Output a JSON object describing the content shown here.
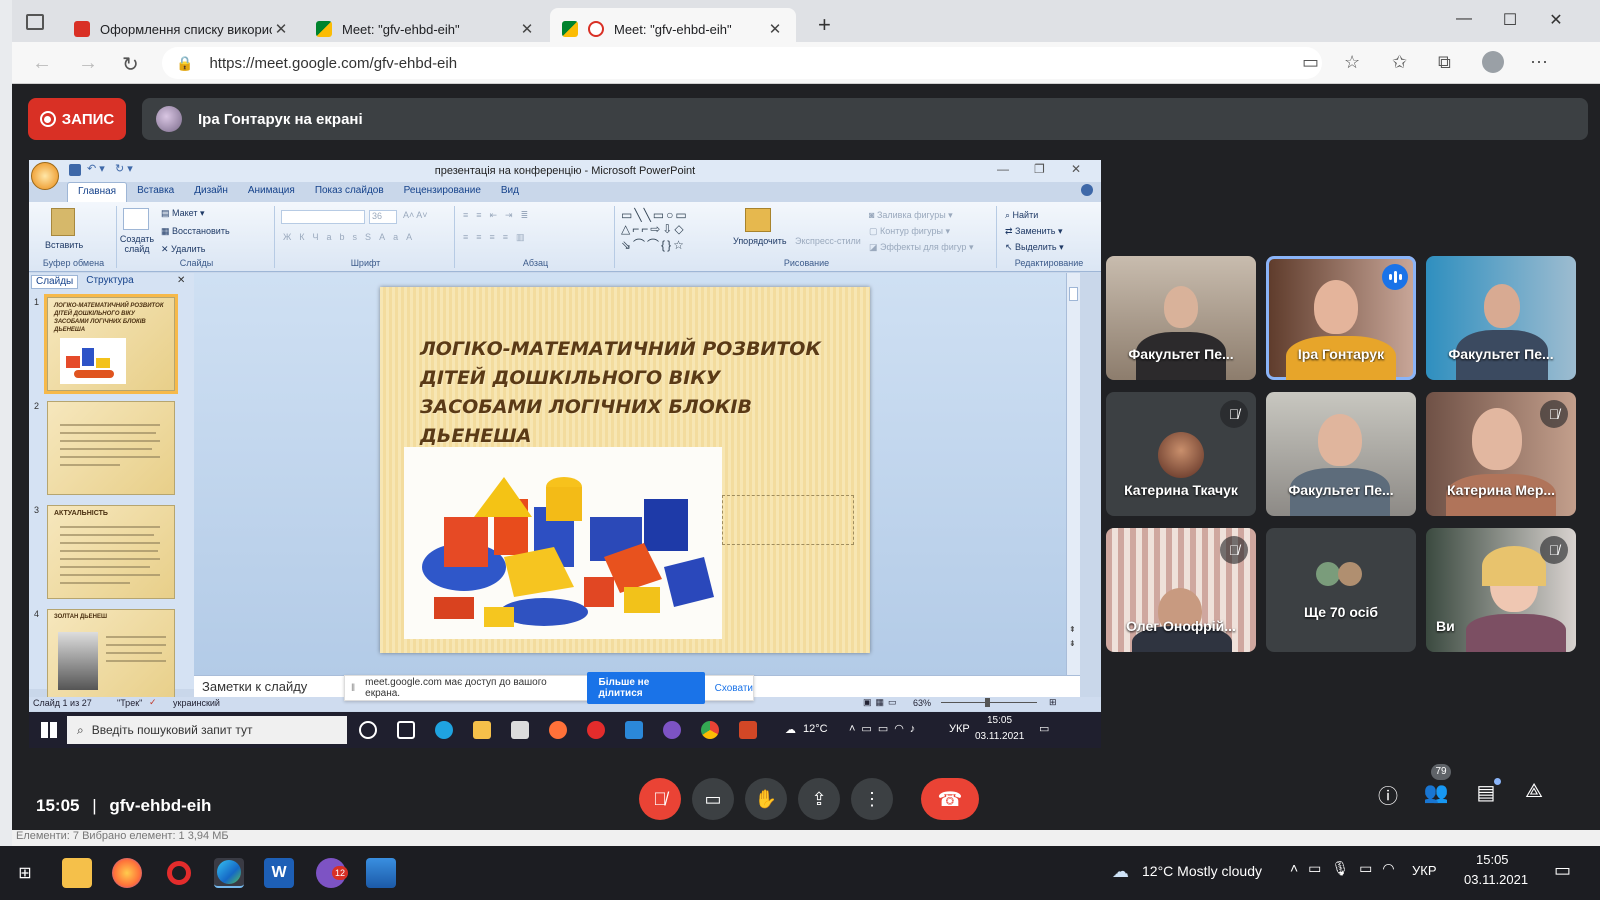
{
  "browser": {
    "tabs": [
      {
        "title": "Оформлення списку використа",
        "favicon_color": "#d93025"
      },
      {
        "title": "Meet: \"gfv-ehbd-eih\"",
        "favicon_color": "#00832d"
      },
      {
        "title": "Meet: \"gfv-ehbd-eih\"",
        "favicon_color": "#00832d",
        "active": true
      }
    ],
    "new_tab_icon": "plus-icon",
    "url": "https://meet.google.com/gfv-ehbd-eih"
  },
  "meet": {
    "record_label": "ЗАПИС",
    "presenter_text": "Іра Гонтарук на екрані",
    "time": "15:05",
    "separator": "|",
    "meeting_code": "gfv-ehbd-eih",
    "people_count": "79",
    "accent_color": "#1a73e8",
    "danger_color": "#ea4335"
  },
  "ppt": {
    "window_title": "презентація на конференцію - Microsoft PowerPoint",
    "ribbon_tabs": [
      "Главная",
      "Вставка",
      "Дизайн",
      "Анимация",
      "Показ слайдов",
      "Рецензирование",
      "Вид"
    ],
    "groups": {
      "clipboard": {
        "label": "Буфер обмена",
        "paste": "Вставить"
      },
      "slides": {
        "label": "Слайды",
        "new_slide": "Создать слайд",
        "layout": "Макет",
        "reset": "Восстановить",
        "delete": "Удалить"
      },
      "font": {
        "label": "Шрифт",
        "size": "36"
      },
      "paragraph": {
        "label": "Абзац"
      },
      "drawing": {
        "label": "Рисование",
        "arrange": "Упорядочить",
        "quick_styles": "Экспресс-стили",
        "fill": "Заливка фигуры",
        "outline": "Контур фигуры",
        "effects": "Эффекты для фигур"
      },
      "editing": {
        "label": "Редактирование",
        "find": "Найти",
        "replace": "Заменить",
        "select": "Выделить"
      }
    },
    "panel_tabs": [
      "Слайды",
      "Структура"
    ],
    "thumbnails": [
      {
        "num": "1",
        "heading": "ЛОГІКО-МАТЕМАТИЧНИЙ РОЗВИТОК ДІТЕЙ ДОШКІЛЬНОГО ВІКУ ЗАСОБАМИ ЛОГІЧНИХ БЛОКІВ ДЬЕНЕША"
      },
      {
        "num": "2",
        "heading": ""
      },
      {
        "num": "3",
        "heading": "АКТУАЛЬНІСТЬ"
      },
      {
        "num": "4",
        "heading": "ЗОЛТАН ДЬЕНЕШ"
      }
    ],
    "slide_title": "ЛОГІКО-МАТЕМАТИЧНИЙ РОЗВИТОК ДІТЕЙ ДОШКІЛЬНОГО ВІКУ ЗАСОБАМИ ЛОГІЧНИХ БЛОКІВ ДЬЕНЕША",
    "notes_placeholder": "Заметки к слайду",
    "status": {
      "slide_of": "Слайд 1 из 27",
      "theme": "\"Трек\"",
      "language": "украинский",
      "zoom": "63%"
    },
    "share_banner": {
      "text": "meet.google.com має доступ до вашого екрана.",
      "stop": "Більше не ділитися",
      "hide": "Сховати"
    }
  },
  "inner_taskbar": {
    "search_placeholder": "Введіть пошуковий запит тут",
    "temp": "12°C",
    "lang": "УКР",
    "time": "15:05",
    "date": "03.11.2021"
  },
  "participants": [
    {
      "name": "Факультет Пе...",
      "muted": false,
      "speaking": false
    },
    {
      "name": "Іра Гонтарук",
      "muted": false,
      "speaking": true
    },
    {
      "name": "Факультет Пе...",
      "muted": false,
      "speaking": false
    },
    {
      "name": "Катерина Ткачук",
      "muted": true,
      "speaking": false
    },
    {
      "name": "Факультет Пе...",
      "muted": false,
      "speaking": false
    },
    {
      "name": "Катерина Мер...",
      "muted": true,
      "speaking": false
    },
    {
      "name": "Олег Онофрій...",
      "muted": true,
      "speaking": false
    },
    {
      "name": "Ще 70 осіб",
      "muted": false,
      "speaking": false
    },
    {
      "name": "Ви",
      "muted": true,
      "speaking": false
    }
  ],
  "explorer_status": "Елементи: 7   Вибрано елемент: 1  3,94 МБ",
  "taskbar": {
    "weather": "12°C  Mostly cloudy",
    "lang": "УКР",
    "time": "15:05",
    "date": "03.11.2021",
    "viber_badge": "12"
  }
}
